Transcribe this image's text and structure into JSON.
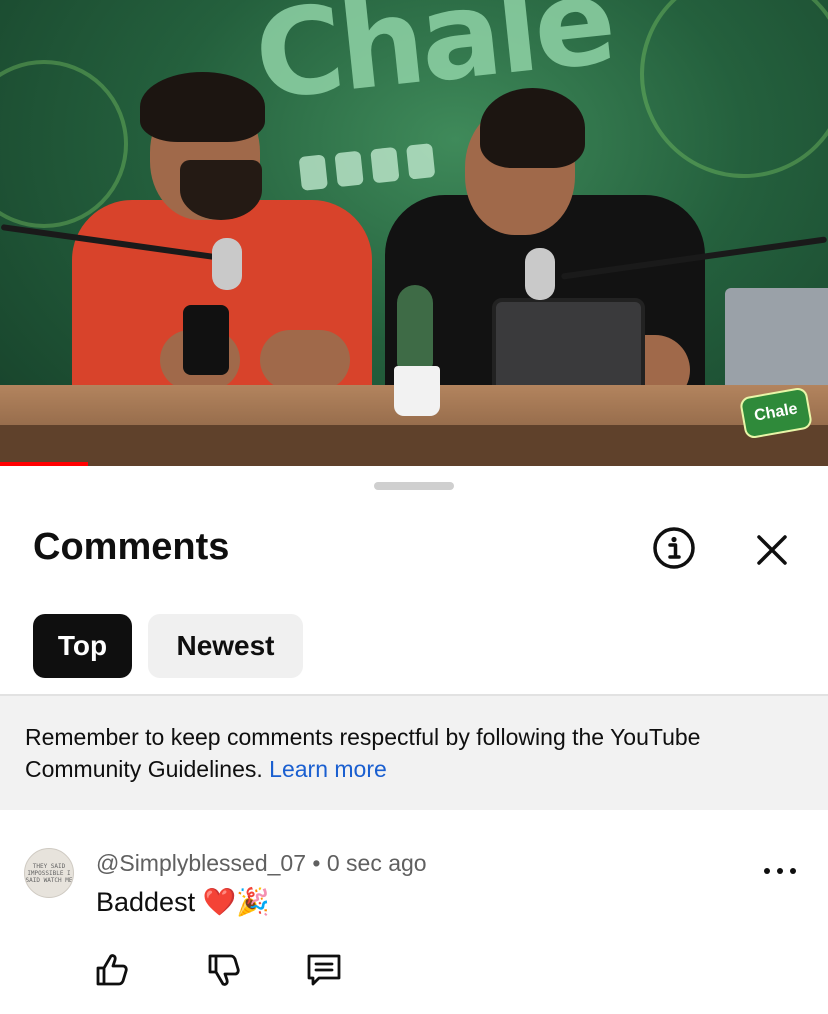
{
  "video": {
    "banner_text": "Chale",
    "logo_badge": "Chale",
    "progress_fraction": 0.106
  },
  "sheet": {
    "title": "Comments",
    "info_icon": "info-circle-icon",
    "close_icon": "close-icon",
    "chips": [
      {
        "label": "Top",
        "selected": true
      },
      {
        "label": "Newest",
        "selected": false
      }
    ],
    "notice": {
      "text": "Remember to keep comments respectful by following the YouTube Community Guidelines.",
      "link": "Learn more"
    }
  },
  "comment": {
    "avatar_text": "THEY SAID IMPOSSIBLE I SAID WATCH ME",
    "author": "@Simplyblessed_07",
    "separator": "•",
    "time": "0 sec ago",
    "text": "Baddest ❤️🎉",
    "actions": [
      "like-icon",
      "dislike-icon",
      "reply-icon"
    ],
    "more_icon": "more-vertical-icon"
  },
  "colors": {
    "accent_link": "#1a5fd0",
    "progress": "#ff0000",
    "chip_selected_bg": "#0f0f0f",
    "chip_bg": "#f0f0f0"
  }
}
